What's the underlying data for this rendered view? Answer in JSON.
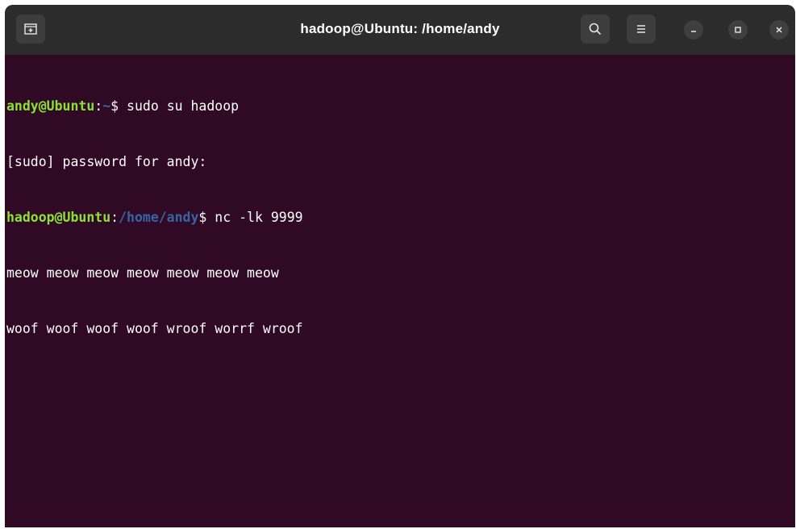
{
  "window": {
    "title": "hadoop@Ubuntu: /home/andy"
  },
  "titlebar": {
    "new_tab_icon": "new-tab-icon",
    "search_icon": "search-icon",
    "menu_icon": "hamburger-menu-icon",
    "minimize_icon": "minimize-icon",
    "maximize_icon": "maximize-icon",
    "close_icon": "close-icon"
  },
  "terminal": {
    "lines": [
      {
        "user": "andy@Ubuntu",
        "sep": ":",
        "path": "~",
        "prompt": "$ ",
        "command": "sudo su hadoop"
      },
      {
        "text": "[sudo] password for andy:"
      },
      {
        "user": "hadoop@Ubuntu",
        "sep": ":",
        "path": "/home/andy",
        "prompt": "$ ",
        "command": "nc -lk 9999"
      },
      {
        "text": "meow meow meow meow meow meow meow"
      },
      {
        "text": "woof woof woof woof wroof worrf wroof"
      }
    ]
  },
  "colors": {
    "background": "#300a24",
    "titlebar": "#2c2c2c",
    "prompt_user": "#8ae234",
    "prompt_path": "#3465a4",
    "text": "#ffffff"
  }
}
